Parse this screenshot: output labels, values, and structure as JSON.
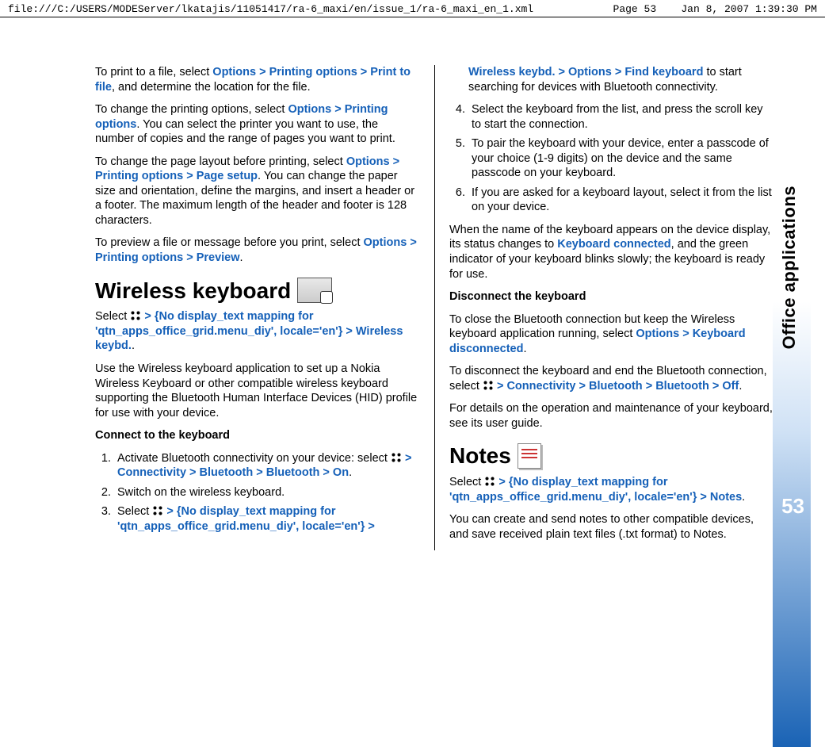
{
  "header": {
    "path": "file:///C:/USERS/MODEServer/lkatajis/11051417/ra-6_maxi/en/issue_1/ra-6_maxi_en_1.xml",
    "page": "Page 53",
    "timestamp": "Jan 8, 2007 1:39:30 PM"
  },
  "side": {
    "label": "Office applications",
    "page_number": "53"
  },
  "left": {
    "p1_a": "To print to a file, select ",
    "p1_m1": "Options",
    "p1_m2": "Printing options",
    "p1_m3": "Print to file",
    "p1_b": ", and determine the location for the file.",
    "p2_a": "To change the printing options, select ",
    "p2_m1": "Options",
    "p2_m2": "Printing options",
    "p2_b": ". You can select the printer you want to use, the number of copies and the range of pages you want to print.",
    "p3_a": "To change the page layout before printing, select ",
    "p3_m1": "Options",
    "p3_m2": "Printing options",
    "p3_m3": "Page setup",
    "p3_b": ". You can change the paper size and orientation, define the margins, and insert a header or a footer. The maximum length of the header and footer is 128 characters.",
    "p4_a": "To preview a file or message before you print, select ",
    "p4_m1": "Options",
    "p4_m2": "Printing options",
    "p4_m3": "Preview",
    "p4_b": ".",
    "h_wireless": "Wireless keyboard",
    "wk_sel_a": "Select ",
    "wk_sel_m1": "{No display_text mapping for 'qtn_apps_office_grid.menu_diy', locale='en'}",
    "wk_sel_m2": "Wireless keybd.",
    "wk_sel_b": ".",
    "wk_p2": "Use the Wireless keyboard application to set up a Nokia Wireless Keyboard or other compatible wireless keyboard supporting the Bluetooth Human Interface Devices (HID) profile for use with your device.",
    "wk_h_connect": "Connect to the keyboard",
    "ol1": {
      "li1_a": "Activate Bluetooth connectivity on your device: select ",
      "li1_m1": "Connectivity",
      "li1_m2": "Bluetooth",
      "li1_m3": "Bluetooth",
      "li1_m4": "On",
      "li1_b": ".",
      "li2": "Switch on the wireless keyboard.",
      "li3_a": "Select ",
      "li3_m1": "{No display_text mapping for 'qtn_apps_office_grid.menu_diy', locale='en'}"
    }
  },
  "right": {
    "cont_m1": "Wireless keybd.",
    "cont_m2": "Options",
    "cont_m3": "Find keyboard",
    "cont_b": " to start searching for devices with Bluetooth connectivity.",
    "ol2": {
      "li4": "Select the keyboard from the list, and press the scroll key to start the connection.",
      "li5": "To pair the keyboard with your device, enter a passcode of your choice (1-9 digits) on the device and the same passcode on your keyboard.",
      "li6": "If you are asked for a keyboard layout, select it from the list on your device."
    },
    "p1_a": "When the name of the keyboard appears on the device display, its status changes to ",
    "p1_m1": "Keyboard connected",
    "p1_b": ", and the green indicator of your keyboard blinks slowly; the keyboard is ready for use.",
    "h_disconnect": "Disconnect the keyboard",
    "p2_a": "To close the Bluetooth connection but keep the Wireless keyboard application running, select ",
    "p2_m1": "Options",
    "p2_m2": "Keyboard disconnected",
    "p2_b": ".",
    "p3_a": "To disconnect the keyboard and end the Bluetooth connection, select ",
    "p3_m1": "Connectivity",
    "p3_m2": "Bluetooth",
    "p3_m3": "Bluetooth",
    "p3_m4": "Off",
    "p3_b": ".",
    "p4": "For details on the operation and maintenance of your keyboard, see its user guide.",
    "h_notes": "Notes",
    "notes_sel_a": "Select ",
    "notes_sel_m1": "{No display_text mapping for 'qtn_apps_office_grid.menu_diy', locale='en'}",
    "notes_sel_m2": "Notes",
    "notes_sel_b": ".",
    "notes_p2": "You can create and send notes to other compatible devices, and save received plain text files (.txt format) to Notes."
  },
  "gt": ">"
}
